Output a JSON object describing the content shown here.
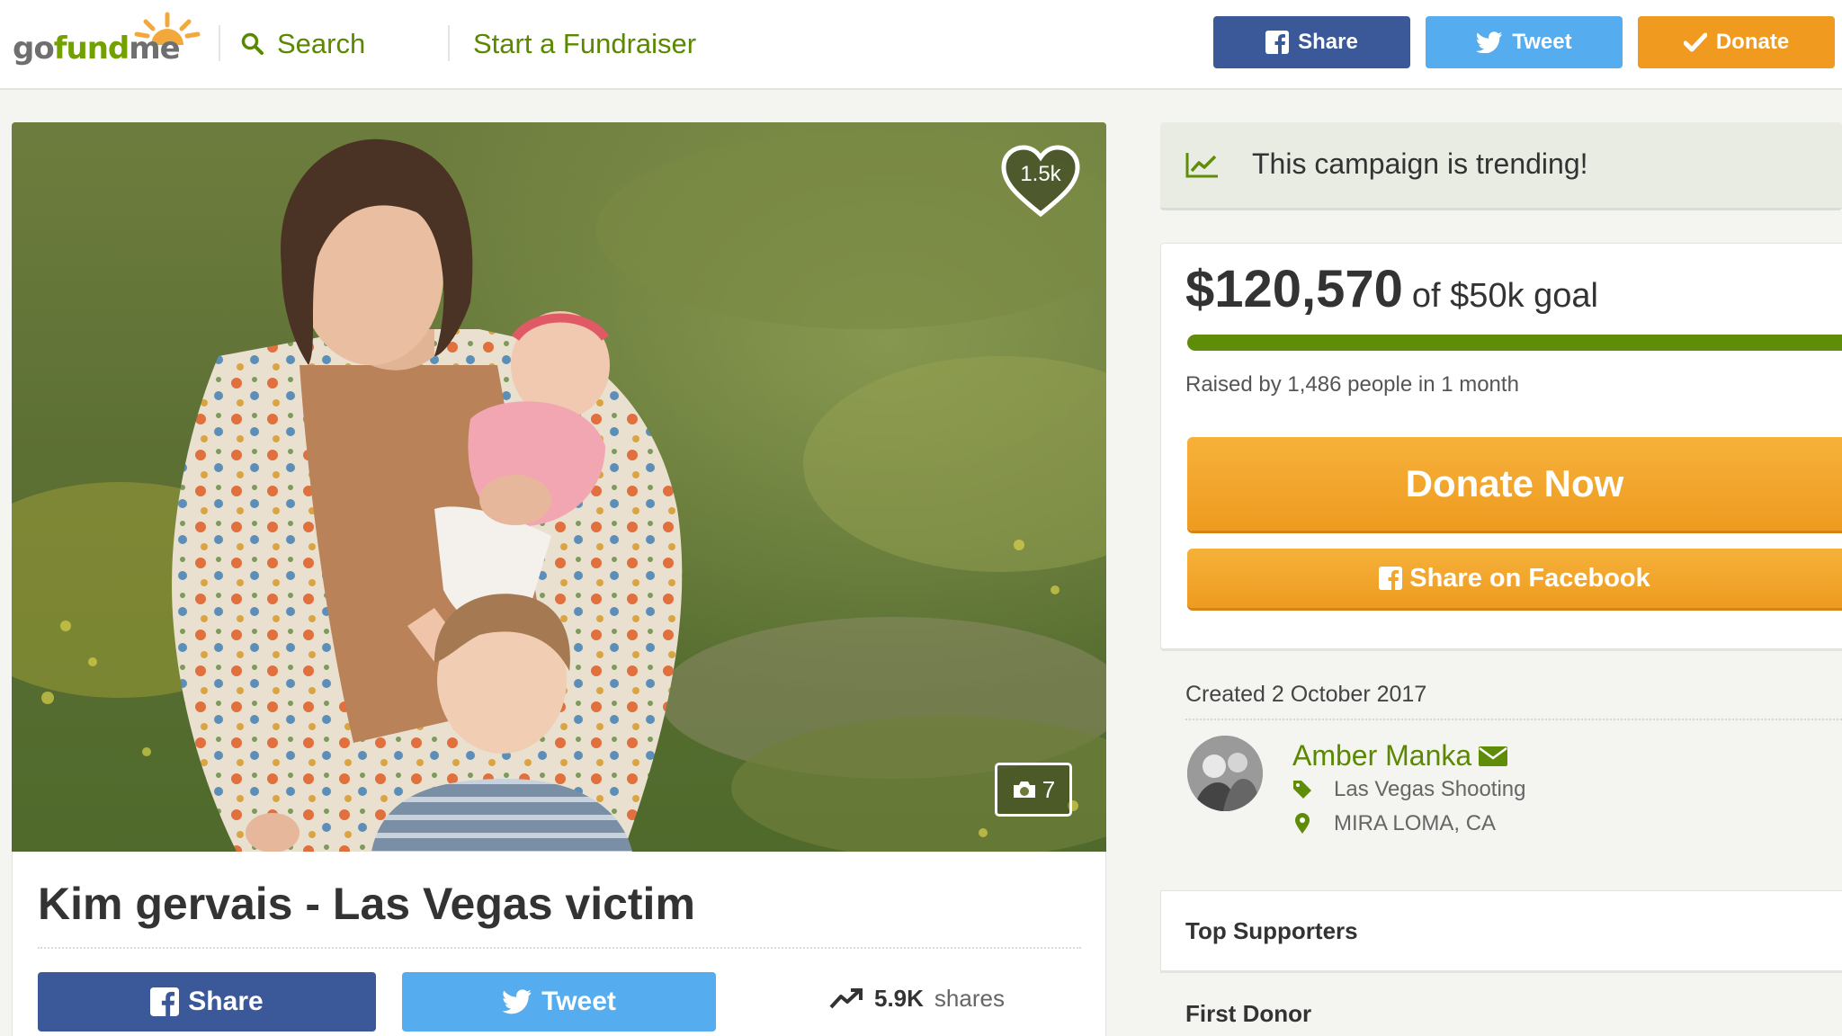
{
  "header": {
    "logo": {
      "go": "go",
      "fund": "fund",
      "me": "me"
    },
    "search_label": "Search",
    "start_label": "Start a Fundraiser",
    "share_label": "Share",
    "tweet_label": "Tweet",
    "donate_label": "Donate"
  },
  "campaign": {
    "title": "Kim gervais - Las Vegas victim",
    "heart_count": "1.5k",
    "photo_count": "7",
    "share_label": "Share",
    "tweet_label": "Tweet",
    "shares_count": "5.9K",
    "shares_suffix": "shares"
  },
  "sidebar": {
    "trending_text": "This campaign is trending!",
    "amount_raised": "$120,570",
    "goal_text": "of $50k goal",
    "progress_fraction": 1.0,
    "raised_by": "Raised by 1,486 people in 1 month",
    "donate_now_label": "Donate Now",
    "share_facebook_label": "Share on Facebook",
    "created": "Created 2 October 2017",
    "organizer_name": "Amber Manka",
    "category": "Las Vegas Shooting",
    "location": "MIRA LOMA, CA",
    "top_supporters_label": "Top Supporters",
    "first_donor_label": "First Donor"
  },
  "colors": {
    "brand_green": "#72a100",
    "facebook_blue": "#3b5998",
    "twitter_blue": "#55acee",
    "donate_orange": "#f09b1f",
    "progress_green": "#5f8d09"
  }
}
